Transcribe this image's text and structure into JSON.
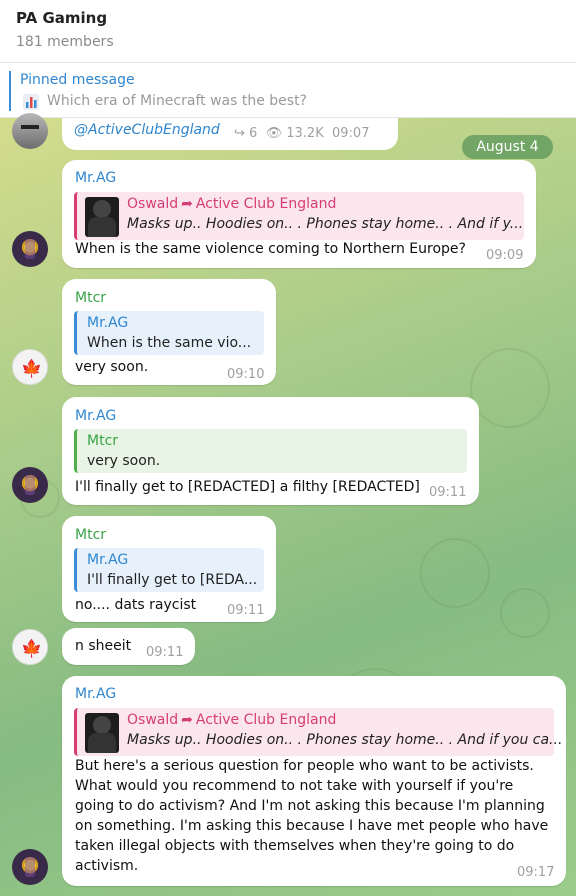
{
  "header": {
    "title": "PA Gaming",
    "members": "181 members"
  },
  "pinned": {
    "title": "Pinned message",
    "icon": "bar-chart-icon",
    "text": "Which era of Minecraft was the best?"
  },
  "top_message": {
    "link": "@ActiveClubEngland",
    "shares": "6",
    "views": "13.2K",
    "time": "09:07"
  },
  "date_pill": "August 4",
  "messages": [
    {
      "sender": "Mr.AG",
      "forward": {
        "author": "Oswald",
        "channel": "Active Club England",
        "text": "Masks up.. Hoodies on.. . Phones stay home.. . And if y..."
      },
      "text": "When is the same violence coming to Northern Europe?",
      "time": "09:09"
    },
    {
      "sender": "Mtcr",
      "reply": {
        "name": "Mr.AG",
        "text": "When is the same vio..."
      },
      "text": "very soon.",
      "time": "09:10"
    },
    {
      "sender": "Mr.AG",
      "reply": {
        "name": "Mtcr",
        "text": "very soon."
      },
      "text": "I'll finally get to [REDACTED] a filthy [REDACTED]",
      "time": "09:11"
    },
    {
      "sender": "Mtcr",
      "reply": {
        "name": "Mr.AG",
        "text": "I'll finally get to [REDA..."
      },
      "text": "no.... dats raycist",
      "time": "09:11"
    },
    {
      "text": "n sheeit",
      "time": "09:11"
    },
    {
      "sender": "Mr.AG",
      "forward": {
        "author": "Oswald",
        "channel": "Active Club England",
        "text": "Masks up.. Hoodies on.. . Phones stay home.. . And if you ca..."
      },
      "lines": [
        "But here's a serious question for people who want to be activists.",
        "What would you recommend to not take with yourself if you're",
        "going to do activism?  And I'm not asking this because I'm planning",
        "on something. I'm asking this because I have met people who have",
        "taken illegal objects with themselves when they're going to do",
        "activism."
      ],
      "time": "09:17"
    }
  ]
}
